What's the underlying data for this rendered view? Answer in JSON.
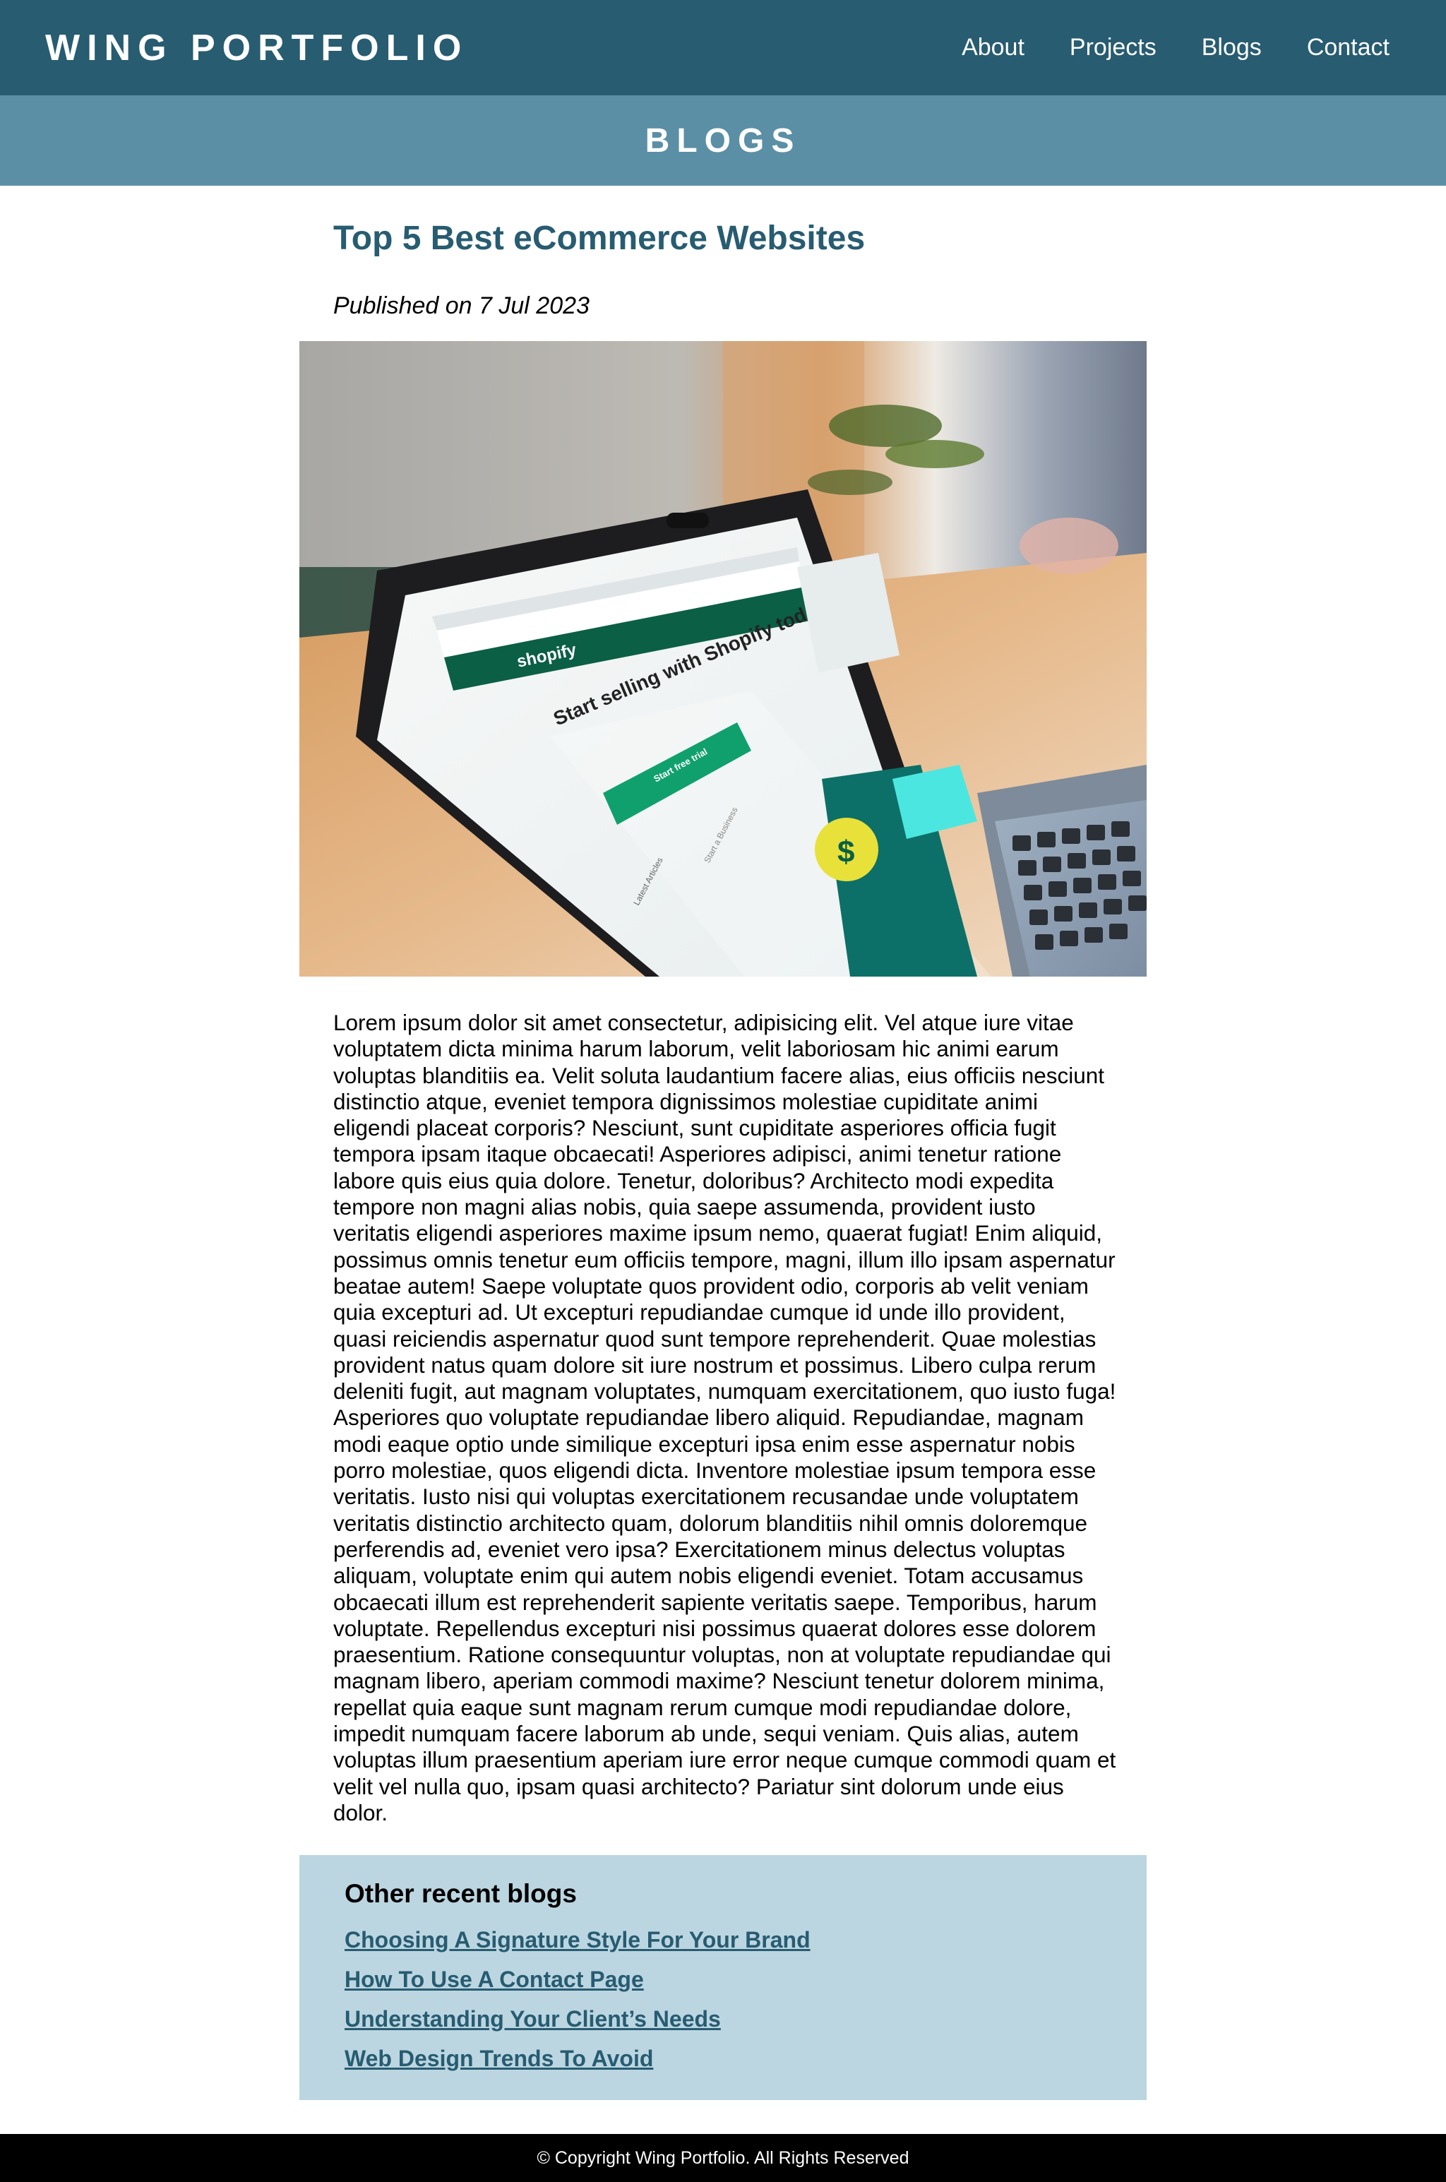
{
  "header": {
    "brand": "WING PORTFOLIO",
    "nav": [
      "About",
      "Projects",
      "Blogs",
      "Contact"
    ]
  },
  "banner": {
    "title": "BLOGS"
  },
  "article": {
    "title": "Top 5 Best eCommerce Websites",
    "published": "Published on 7 Jul 2023",
    "image": {
      "description_icon": "laptop-photo-icon",
      "store_name": "shopify",
      "headline": "Start selling with Shopify today",
      "cta": "Start free trial",
      "tabs": [
        "Latest Articles",
        "Start a Business"
      ]
    },
    "body": "Lorem ipsum dolor sit amet consectetur, adipisicing elit. Vel atque iure vitae voluptatem dicta minima harum laborum, velit laboriosam hic animi earum voluptas blanditiis ea. Velit soluta laudantium facere alias, eius officiis nesciunt distinctio atque, eveniet tempora dignissimos molestiae cupiditate animi eligendi placeat corporis? Nesciunt, sunt cupiditate asperiores officia fugit tempora ipsam itaque obcaecati! Asperiores adipisci, animi tenetur ratione labore quis eius quia dolore. Tenetur, doloribus? Architecto modi expedita tempore non magni alias nobis, quia saepe assumenda, provident iusto veritatis eligendi asperiores maxime ipsum nemo, quaerat fugiat! Enim aliquid, possimus omnis tenetur eum officiis tempore, magni, illum illo ipsam aspernatur beatae autem! Saepe voluptate quos provident odio, corporis ab velit veniam quia excepturi ad. Ut excepturi repudiandae cumque id unde illo provident, quasi reiciendis aspernatur quod sunt tempore reprehenderit. Quae molestias provident natus quam dolore sit iure nostrum et possimus. Libero culpa rerum deleniti fugit, aut magnam voluptates, numquam exercitationem, quo iusto fuga! Asperiores quo voluptate repudiandae libero aliquid. Repudiandae, magnam modi eaque optio unde similique excepturi ipsa enim esse aspernatur nobis porro molestiae, quos eligendi dicta. Inventore molestiae ipsum tempora esse veritatis. Iusto nisi qui voluptas exercitationem recusandae unde voluptatem veritatis distinctio architecto quam, dolorum blanditiis nihil omnis doloremque perferendis ad, eveniet vero ipsa? Exercitationem minus delectus voluptas aliquam, voluptate enim qui autem nobis eligendi eveniet. Totam accusamus obcaecati illum est reprehenderit sapiente veritatis saepe. Temporibus, harum voluptate. Repellendus excepturi nisi possimus quaerat dolores esse dolorem praesentium. Ratione consequuntur voluptas, non at voluptate repudiandae qui magnam libero, aperiam commodi maxime? Nesciunt tenetur dolorem minima, repellat quia eaque sunt magnam rerum cumque modi repudiandae dolore, impedit numquam facere laborum ab unde, sequi veniam. Quis alias, autem voluptas illum praesentium aperiam iure error neque cumque commodi quam et velit vel nulla quo, ipsam quasi architecto? Pariatur sint dolorum unde eius dolor."
  },
  "recent": {
    "heading": "Other recent blogs",
    "links": [
      "Choosing A Signature Style For Your Brand",
      "How To Use A Contact Page",
      "Understanding Your Client’s Needs",
      "Web Design Trends To Avoid"
    ]
  },
  "footer": {
    "text": "© Copyright Wing Portfolio. All Rights Reserved"
  },
  "colors": {
    "header_bg": "#275c71",
    "banner_bg": "#5b8fa6",
    "title_color": "#275c71",
    "recent_bg": "#bcd6e1",
    "footer_bg": "#000000",
    "shopify_green": "#0b5f45",
    "cta_green": "#10a06e"
  }
}
